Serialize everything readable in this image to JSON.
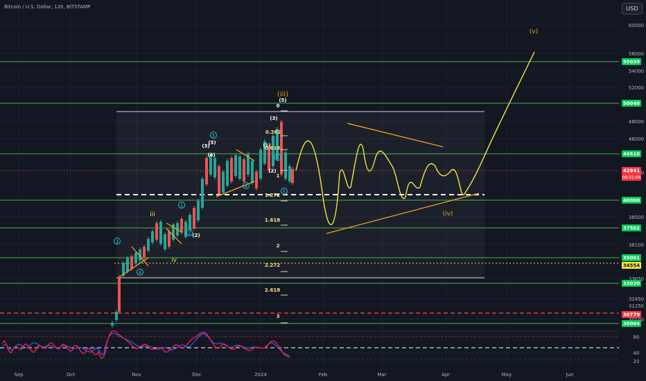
{
  "header": {
    "title": "Bitcoin / U.S. Dollar, 12h, BITSTAMP"
  },
  "currency_button": "USD",
  "colors": {
    "background": "#131722",
    "grid": "#1e222d",
    "hline_green": "#4caf50",
    "fib_white": "#d1d4dc",
    "price_red": "#f23645",
    "projection_yellow": "#f5e642",
    "trendline_orange": "#f5a623",
    "candle_up": "#26a69a",
    "candle_down": "#ef5350",
    "label_green": "#00c853",
    "label_yellow": "#f5e642",
    "label_red": "#f23645",
    "rsi_red": "#ff1744",
    "rsi_blue": "#2962ff"
  },
  "price_axis": {
    "ticks": [
      "60000",
      "56000",
      "54000",
      "52000",
      "48000",
      "46000",
      "42000",
      "38500",
      "36100",
      "33650",
      "32450",
      "31250",
      "30100",
      "80",
      "40",
      "20"
    ],
    "badges": [
      {
        "value": "55039",
        "style": "green"
      },
      {
        "value": "50040",
        "style": "green"
      },
      {
        "value": "44510",
        "style": "green"
      },
      {
        "value": "42841",
        "style": "red",
        "sub": "09:31:04"
      },
      {
        "value": "40000",
        "style": "green"
      },
      {
        "value": "37502",
        "style": "green"
      },
      {
        "value": "35001",
        "style": "green"
      },
      {
        "value": "34554",
        "style": "yellow"
      },
      {
        "value": "33020",
        "style": "green"
      },
      {
        "value": "30779",
        "style": "red"
      },
      {
        "value": "30004",
        "style": "green"
      }
    ]
  },
  "time_axis": {
    "labels": [
      "Sep",
      "Oct",
      "Nov",
      "Dec",
      "2024",
      "Feb",
      "Mar",
      "Apr",
      "May",
      "Jun"
    ]
  },
  "fib_levels": [
    "0",
    "0.382",
    "0.618",
    "1",
    "1.272",
    "1.618",
    "2",
    "2.272",
    "2.618",
    "3"
  ],
  "wave_labels": {
    "circled_numbers": [
      "1",
      "2",
      "3",
      "4",
      "5"
    ],
    "paren_numbers": [
      "(1)",
      "(2)",
      "(3)",
      "(4)",
      "(5)"
    ],
    "minor": [
      "iii",
      "iv"
    ],
    "major": [
      "(iii)",
      "(iv)",
      "(v)"
    ]
  },
  "rsi": {
    "levels": [
      "80",
      "40",
      "20"
    ]
  }
}
